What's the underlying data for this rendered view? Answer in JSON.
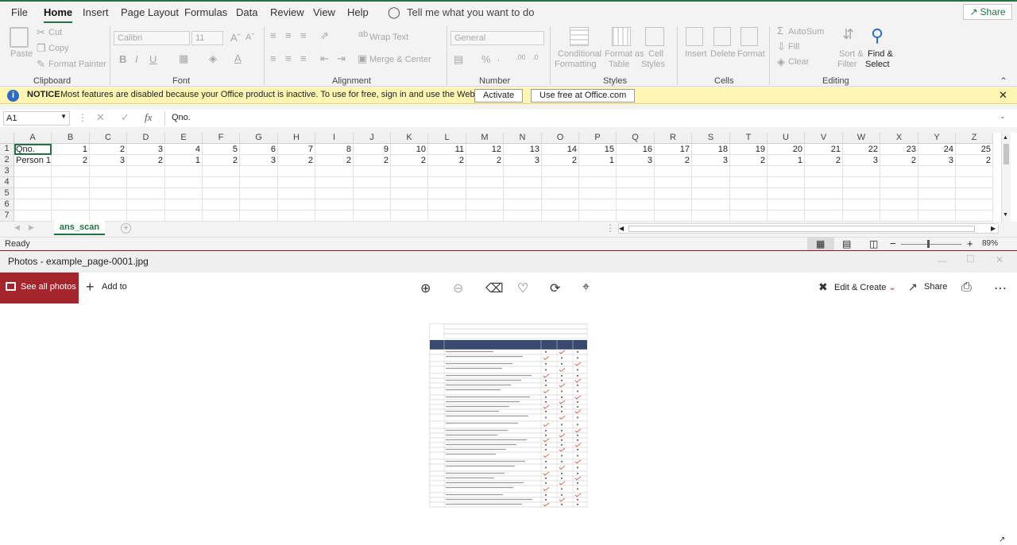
{
  "excel": {
    "menu": [
      "File",
      "Home",
      "Insert",
      "Page Layout",
      "Formulas",
      "Data",
      "Review",
      "View",
      "Help"
    ],
    "tell_me": "Tell me what you want to do",
    "share": "Share",
    "ribbon": {
      "clipboard": {
        "label": "Clipboard",
        "paste": "Paste",
        "cut": "Cut",
        "copy": "Copy",
        "format_painter": "Format Painter"
      },
      "font": {
        "label": "Font",
        "name": "Calibri",
        "size": "11"
      },
      "alignment": {
        "label": "Alignment",
        "wrap": "Wrap Text",
        "merge": "Merge & Center"
      },
      "number": {
        "label": "Number",
        "format": "General"
      },
      "styles": {
        "label": "Styles",
        "cond1": "Conditional",
        "cond2": "Formatting",
        "fmt1": "Format as",
        "fmt2": "Table",
        "cell1": "Cell",
        "cell2": "Styles"
      },
      "cells": {
        "label": "Cells",
        "insert": "Insert",
        "delete": "Delete",
        "format": "Format"
      },
      "editing": {
        "label": "Editing",
        "autosum": "AutoSum",
        "fill": "Fill",
        "clear": "Clear",
        "sort1": "Sort &",
        "sort2": "Filter",
        "find1": "Find &",
        "find2": "Select"
      }
    },
    "notice": {
      "title": "NOTICE",
      "text": "Most features are disabled because your Office product is inactive. To use for free, sign in and use the Web version.",
      "activate": "Activate",
      "web": "Use free at Office.com"
    },
    "namebox": "A1",
    "formula": "Qno.",
    "fx": "fx",
    "columns": [
      "A",
      "B",
      "C",
      "D",
      "E",
      "F",
      "G",
      "H",
      "I",
      "J",
      "K",
      "L",
      "M",
      "N",
      "O",
      "P",
      "Q",
      "R",
      "S",
      "T",
      "U",
      "V",
      "W",
      "X",
      "Y",
      "Z"
    ],
    "rows": [
      "1",
      "2",
      "3",
      "4",
      "5",
      "6",
      "7"
    ],
    "row1": [
      "Qno.",
      "1",
      "2",
      "3",
      "4",
      "5",
      "6",
      "7",
      "8",
      "9",
      "10",
      "11",
      "12",
      "13",
      "14",
      "15",
      "16",
      "17",
      "18",
      "19",
      "20",
      "21",
      "22",
      "23",
      "24",
      "25"
    ],
    "row2": [
      "Person 1",
      "2",
      "3",
      "2",
      "1",
      "2",
      "3",
      "2",
      "2",
      "2",
      "2",
      "2",
      "2",
      "3",
      "2",
      "1",
      "3",
      "2",
      "3",
      "2",
      "1",
      "2",
      "3",
      "2",
      "3",
      "2"
    ],
    "sheet_tab": "ans_scan",
    "status": "Ready",
    "zoom": "89%",
    "colors": {
      "green": "#217346",
      "notice_bg": "#fff5b3"
    }
  },
  "photos": {
    "title": "Photos - example_page-0001.jpg",
    "see_all": "See all photos",
    "add_to": "Add to",
    "edit_create": "Edit & Create",
    "share": "Share",
    "colors": {
      "accent": "#a4262c"
    }
  }
}
